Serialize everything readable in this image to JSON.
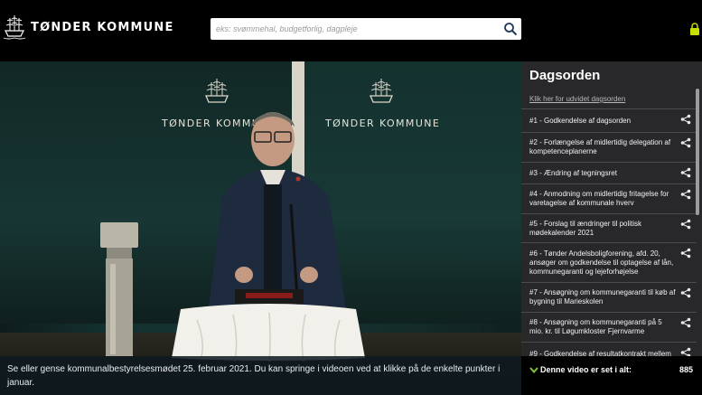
{
  "header": {
    "brand": "TØNDER KOMMUNE",
    "search_placeholder": "eks: svømmehal, budgetforlig, dagpleje",
    "icons": {
      "logo": "ship-crest-icon",
      "search": "search-icon",
      "lock": "lock-icon"
    }
  },
  "video": {
    "wall_label_left": "TØNDER KOMMUNE",
    "wall_label_right": "TØNDER KOMMUNE",
    "caption": "Se eller gense kommunalbestyrelsesmødet 25. februar 2021. Du kan springe i videoen ved at klikke på de enkelte punkter i januar."
  },
  "agenda": {
    "title": "Dagsorden",
    "expand_link": "Klik her for udvidet dagsorden",
    "items": [
      {
        "label": "#1 - Godkendelse af dagsorden"
      },
      {
        "label": "#2 - Forlængelse af midlertidig delegation af kompetenceplanerne"
      },
      {
        "label": "#3 - Ændring af tegningsret"
      },
      {
        "label": "#4 - Anmodning om midlertidig fritagelse for varetagelse af kommunale hverv"
      },
      {
        "label": "#5 - Forslag til ændringer til politisk mødekalender 2021"
      },
      {
        "label": "#6 - Tønder Andelsboligforening, afd. 20, ansøger om godkendelse til optagelse af lån, kommunegaranti og lejeforhøjelse"
      },
      {
        "label": "#7 - Ansøgning om kommunegaranti til køb af bygning til Marieskolen"
      },
      {
        "label": "#8 - Ansøgning om kommunegaranti på 5 mio. kr. til Løgumkloster Fjernvarme"
      },
      {
        "label": "#9 - Godkendelse af resultatkontrakt mellem"
      }
    ]
  },
  "views": {
    "label": "Denne video er set i alt:",
    "count": "885"
  },
  "colors": {
    "background": "#000000",
    "panel": "#2c2c30",
    "accent_green": "#7ec636",
    "lock_green": "#c7e000"
  }
}
